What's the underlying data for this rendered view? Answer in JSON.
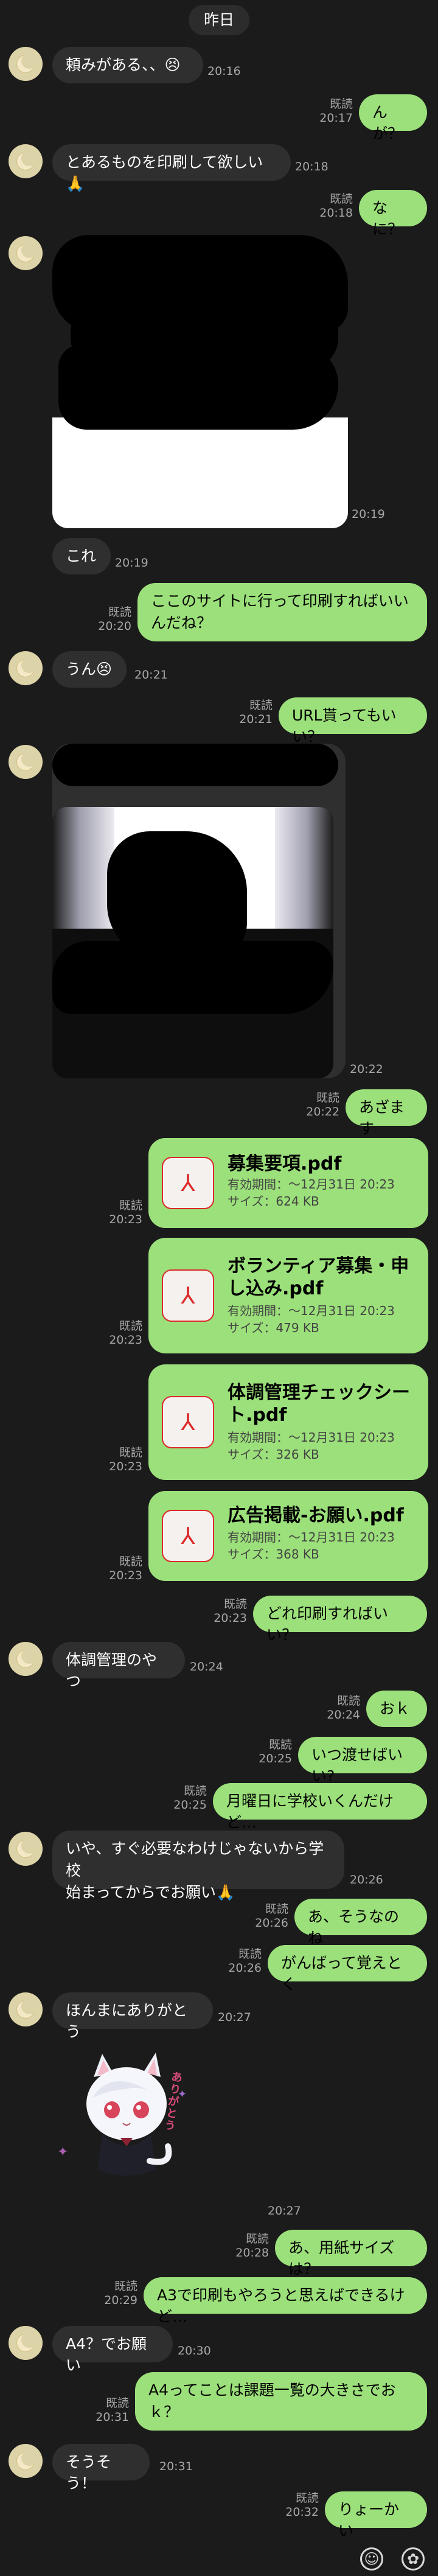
{
  "date": "昨日",
  "messages": {
    "m1": {
      "text": "頼みがある、、😣",
      "time": "20:16"
    },
    "m2": {
      "text": "んが？",
      "read": "既読",
      "time": "20:17"
    },
    "m3": {
      "text": "とあるものを印刷して欲しい🙏",
      "time": "20:18"
    },
    "m4": {
      "text": "なに？",
      "read": "既読",
      "time": "20:18"
    },
    "m5": {
      "time": "20:19"
    },
    "m6": {
      "text": "これ",
      "time": "20:19"
    },
    "m7": {
      "text": "ここのサイトに行って印刷すればいい\nんだね？",
      "read": "既読",
      "time": "20:20"
    },
    "m8": {
      "text": "うん😣",
      "time": "20:21"
    },
    "m9": {
      "text": "URL貰ってもいい？",
      "read": "既読",
      "time": "20:21"
    },
    "m10": {
      "time": "20:22"
    },
    "m11": {
      "text": "あざます",
      "read": "既読",
      "time": "20:22"
    },
    "m12": {
      "read": "既読",
      "time": "20:23"
    },
    "m13": {
      "read": "既読",
      "time": "20:23"
    },
    "m14": {
      "read": "既読",
      "time": "20:23"
    },
    "m15": {
      "read": "既読",
      "time": "20:23"
    },
    "m16": {
      "text": "どれ印刷すればいい？",
      "read": "既読",
      "time": "20:23"
    },
    "m17": {
      "text": "体調管理のやつ",
      "time": "20:24"
    },
    "m18": {
      "text": "おｋ",
      "read": "既読",
      "time": "20:24"
    },
    "m19": {
      "text": "いつ渡せばいい?",
      "read": "既読",
      "time": "20:25"
    },
    "m20": {
      "text": "月曜日に学校いくんだけど…",
      "read": "既読",
      "time": "20:25"
    },
    "m21": {
      "text": "いや、すぐ必要なわけじゃないから学校\n始まってからでお願い🙏",
      "time": "20:26"
    },
    "m22": {
      "text": "あ、そうなのね",
      "read": "既読",
      "time": "20:26"
    },
    "m23": {
      "text": "がんばって覚えとく",
      "read": "既読",
      "time": "20:26"
    },
    "m24": {
      "text": "ほんまにありがとう",
      "time": "20:27"
    },
    "m25": {
      "time": "20:27"
    },
    "m26": {
      "text": "あ、用紙サイズは？",
      "read": "既読",
      "time": "20:28"
    },
    "m27": {
      "text": "A3で印刷もやろうと思えばできるけど…",
      "read": "既読",
      "time": "20:29"
    },
    "m28": {
      "text": "A4？でお願い",
      "time": "20:30"
    },
    "m29": {
      "text": "A4ってことは課題一覧の大きさでお\nｋ？",
      "read": "既読",
      "time": "20:31"
    },
    "m30": {
      "text": "そうそう！",
      "time": "20:31"
    },
    "m31": {
      "text": "りょーかい",
      "read": "既読",
      "time": "20:32"
    }
  },
  "files": [
    {
      "name": "募集要項.pdf",
      "expiry": "有効期間：〜12月31日 20:23",
      "size": "サイズ：624 KB"
    },
    {
      "name": "ボランティア募集・申し込み.pdf",
      "expiry": "有効期間：〜12月31日 20:23",
      "size": "サイズ：479 KB"
    },
    {
      "name": "体調管理チェックシート.pdf",
      "expiry": "有効期間：〜12月31日 20:23",
      "size": "サイズ：326 KB"
    },
    {
      "name": "広告掲載-お願い.pdf",
      "expiry": "有効期間：〜12月31日 20:23",
      "size": "サイズ：368 KB"
    }
  ],
  "sticker": {
    "caption": "ありがとう"
  },
  "colors": {
    "background": "#1b1b1b",
    "incoming_bubble": "#2f2f2f",
    "outgoing_bubble": "#9be07a",
    "pdf_red": "#dc2a2a"
  },
  "icons": {
    "emoji": "smile-icon",
    "sticker": "sticker-icon"
  }
}
